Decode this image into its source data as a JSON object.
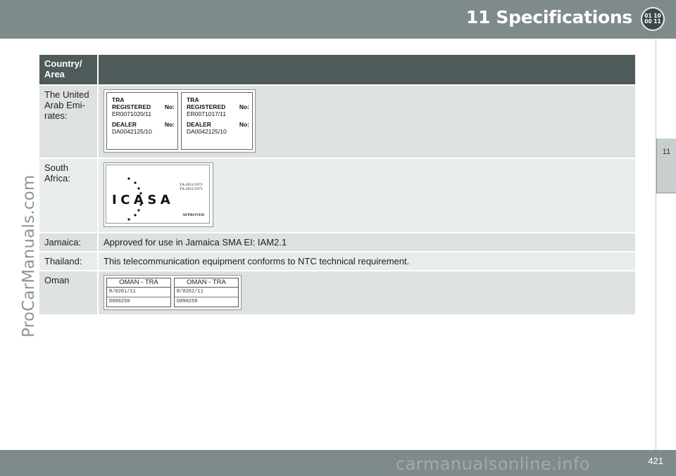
{
  "header": {
    "title": "11 Specifications",
    "chapter_icon_rows": [
      "01 10",
      "00 11"
    ]
  },
  "side_tab": {
    "label": "11"
  },
  "watermark": {
    "left": "ProCarManuals.com",
    "bottom": "carmanualsonline.info"
  },
  "table": {
    "header_col1": "Country/ Area",
    "header_col2": "",
    "rows": [
      {
        "country": "The United Arab Emi-rates:",
        "badges": [
          {
            "title": "TRA",
            "reg_label": "REGISTERED",
            "reg_no_label": "No:",
            "reg_no": "ER0071020/11",
            "dealer_label": "DEALER",
            "dealer_no_label": "No:",
            "dealer_no": "DA0042125/10"
          },
          {
            "title": "TRA",
            "reg_label": "REGISTERED",
            "reg_no_label": "No:",
            "reg_no": "ER0071017/11",
            "dealer_label": "DEALER",
            "dealer_no_label": "No:",
            "dealer_no": "DA0042125/10"
          }
        ]
      },
      {
        "country": "South Africa:",
        "icasa": {
          "logo": "ICASA",
          "ta1": "TA-2011/1072",
          "ta2": "TA-2011/1073",
          "status": "APPROVED"
        }
      },
      {
        "country": "Jamaica:",
        "text": "Approved for use in Jamaica SMA EI: IAM2.1"
      },
      {
        "country": "Thailand:",
        "text": "This telecommunication equipment conforms to NTC technical requirement."
      },
      {
        "country": "Oman",
        "oman": [
          {
            "title": "OMAN - TRA",
            "line1": "R/0261/11",
            "line2": "D090258"
          },
          {
            "title": "OMAN - TRA",
            "line1": "R/0262/11",
            "line2": "D090258"
          }
        ]
      }
    ]
  },
  "footer": {
    "page_number": "421"
  }
}
